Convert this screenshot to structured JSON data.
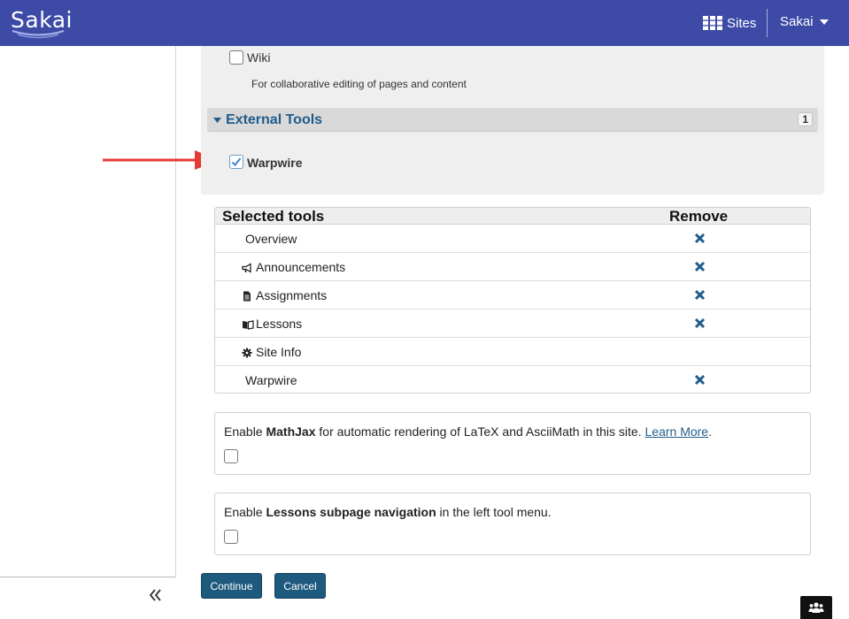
{
  "header": {
    "logo_text": "Sakai",
    "sites_label": "Sites",
    "user_label": "Sakai"
  },
  "tool_list": {
    "wiki_label": "Wiki",
    "wiki_description": "For collaborative editing of pages and content",
    "external_tools_title": "External Tools",
    "external_tools_count": "1",
    "warpwire_label": "Warpwire",
    "warpwire_checked": true
  },
  "selected_tools": {
    "header_left": "Selected tools",
    "header_right": "Remove",
    "rows": [
      {
        "label": "Overview",
        "icon": "none",
        "removable": true
      },
      {
        "label": "Announcements",
        "icon": "megaphone-icon",
        "removable": true
      },
      {
        "label": "Assignments",
        "icon": "document-icon",
        "removable": true
      },
      {
        "label": "Lessons",
        "icon": "book-icon",
        "removable": true
      },
      {
        "label": "Site Info",
        "icon": "gear-icon",
        "removable": false
      },
      {
        "label": "Warpwire",
        "icon": "none",
        "removable": true
      }
    ]
  },
  "options": {
    "mathjax": {
      "prefix": "Enable ",
      "bold": "MathJax",
      "suffix": " for automatic rendering of LaTeX and AsciiMath in this site. ",
      "link": "Learn More",
      "end": "."
    },
    "lessons_nav": {
      "prefix": "Enable ",
      "bold": "Lessons subpage navigation",
      "suffix": " in the left tool menu."
    }
  },
  "buttons": {
    "continue": "Continue",
    "cancel": "Cancel"
  },
  "colors": {
    "header_bg": "#3d4aa6",
    "accent": "#1f5c8b",
    "button_bg": "#1e5a7e",
    "arrow": "#e53935"
  }
}
